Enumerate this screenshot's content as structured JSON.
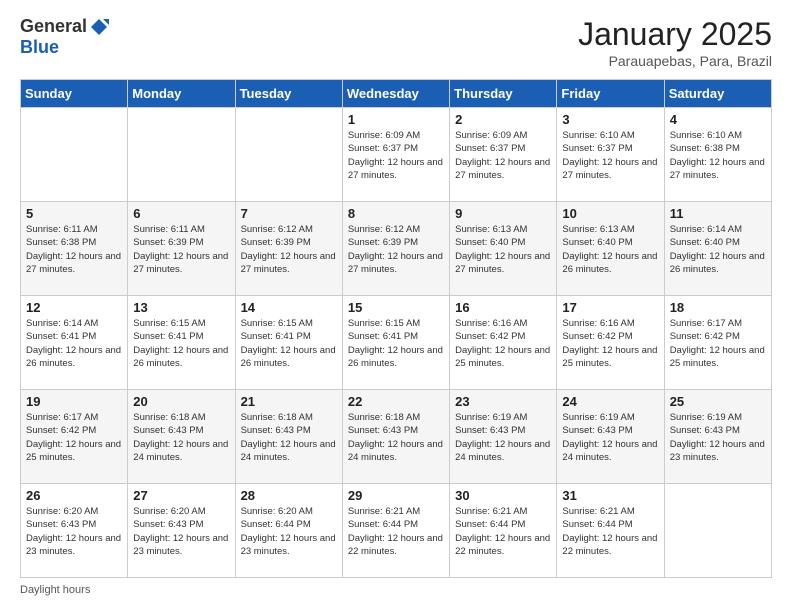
{
  "logo": {
    "general": "General",
    "blue": "Blue"
  },
  "title": "January 2025",
  "subtitle": "Parauapebas, Para, Brazil",
  "days_of_week": [
    "Sunday",
    "Monday",
    "Tuesday",
    "Wednesday",
    "Thursday",
    "Friday",
    "Saturday"
  ],
  "footer": "Daylight hours",
  "weeks": [
    [
      {
        "day": "",
        "info": ""
      },
      {
        "day": "",
        "info": ""
      },
      {
        "day": "",
        "info": ""
      },
      {
        "day": "1",
        "info": "Sunrise: 6:09 AM\nSunset: 6:37 PM\nDaylight: 12 hours and 27 minutes."
      },
      {
        "day": "2",
        "info": "Sunrise: 6:09 AM\nSunset: 6:37 PM\nDaylight: 12 hours and 27 minutes."
      },
      {
        "day": "3",
        "info": "Sunrise: 6:10 AM\nSunset: 6:37 PM\nDaylight: 12 hours and 27 minutes."
      },
      {
        "day": "4",
        "info": "Sunrise: 6:10 AM\nSunset: 6:38 PM\nDaylight: 12 hours and 27 minutes."
      }
    ],
    [
      {
        "day": "5",
        "info": "Sunrise: 6:11 AM\nSunset: 6:38 PM\nDaylight: 12 hours and 27 minutes."
      },
      {
        "day": "6",
        "info": "Sunrise: 6:11 AM\nSunset: 6:39 PM\nDaylight: 12 hours and 27 minutes."
      },
      {
        "day": "7",
        "info": "Sunrise: 6:12 AM\nSunset: 6:39 PM\nDaylight: 12 hours and 27 minutes."
      },
      {
        "day": "8",
        "info": "Sunrise: 6:12 AM\nSunset: 6:39 PM\nDaylight: 12 hours and 27 minutes."
      },
      {
        "day": "9",
        "info": "Sunrise: 6:13 AM\nSunset: 6:40 PM\nDaylight: 12 hours and 27 minutes."
      },
      {
        "day": "10",
        "info": "Sunrise: 6:13 AM\nSunset: 6:40 PM\nDaylight: 12 hours and 26 minutes."
      },
      {
        "day": "11",
        "info": "Sunrise: 6:14 AM\nSunset: 6:40 PM\nDaylight: 12 hours and 26 minutes."
      }
    ],
    [
      {
        "day": "12",
        "info": "Sunrise: 6:14 AM\nSunset: 6:41 PM\nDaylight: 12 hours and 26 minutes."
      },
      {
        "day": "13",
        "info": "Sunrise: 6:15 AM\nSunset: 6:41 PM\nDaylight: 12 hours and 26 minutes."
      },
      {
        "day": "14",
        "info": "Sunrise: 6:15 AM\nSunset: 6:41 PM\nDaylight: 12 hours and 26 minutes."
      },
      {
        "day": "15",
        "info": "Sunrise: 6:15 AM\nSunset: 6:41 PM\nDaylight: 12 hours and 26 minutes."
      },
      {
        "day": "16",
        "info": "Sunrise: 6:16 AM\nSunset: 6:42 PM\nDaylight: 12 hours and 25 minutes."
      },
      {
        "day": "17",
        "info": "Sunrise: 6:16 AM\nSunset: 6:42 PM\nDaylight: 12 hours and 25 minutes."
      },
      {
        "day": "18",
        "info": "Sunrise: 6:17 AM\nSunset: 6:42 PM\nDaylight: 12 hours and 25 minutes."
      }
    ],
    [
      {
        "day": "19",
        "info": "Sunrise: 6:17 AM\nSunset: 6:42 PM\nDaylight: 12 hours and 25 minutes."
      },
      {
        "day": "20",
        "info": "Sunrise: 6:18 AM\nSunset: 6:43 PM\nDaylight: 12 hours and 24 minutes."
      },
      {
        "day": "21",
        "info": "Sunrise: 6:18 AM\nSunset: 6:43 PM\nDaylight: 12 hours and 24 minutes."
      },
      {
        "day": "22",
        "info": "Sunrise: 6:18 AM\nSunset: 6:43 PM\nDaylight: 12 hours and 24 minutes."
      },
      {
        "day": "23",
        "info": "Sunrise: 6:19 AM\nSunset: 6:43 PM\nDaylight: 12 hours and 24 minutes."
      },
      {
        "day": "24",
        "info": "Sunrise: 6:19 AM\nSunset: 6:43 PM\nDaylight: 12 hours and 24 minutes."
      },
      {
        "day": "25",
        "info": "Sunrise: 6:19 AM\nSunset: 6:43 PM\nDaylight: 12 hours and 23 minutes."
      }
    ],
    [
      {
        "day": "26",
        "info": "Sunrise: 6:20 AM\nSunset: 6:43 PM\nDaylight: 12 hours and 23 minutes."
      },
      {
        "day": "27",
        "info": "Sunrise: 6:20 AM\nSunset: 6:43 PM\nDaylight: 12 hours and 23 minutes."
      },
      {
        "day": "28",
        "info": "Sunrise: 6:20 AM\nSunset: 6:44 PM\nDaylight: 12 hours and 23 minutes."
      },
      {
        "day": "29",
        "info": "Sunrise: 6:21 AM\nSunset: 6:44 PM\nDaylight: 12 hours and 22 minutes."
      },
      {
        "day": "30",
        "info": "Sunrise: 6:21 AM\nSunset: 6:44 PM\nDaylight: 12 hours and 22 minutes."
      },
      {
        "day": "31",
        "info": "Sunrise: 6:21 AM\nSunset: 6:44 PM\nDaylight: 12 hours and 22 minutes."
      },
      {
        "day": "",
        "info": ""
      }
    ]
  ]
}
